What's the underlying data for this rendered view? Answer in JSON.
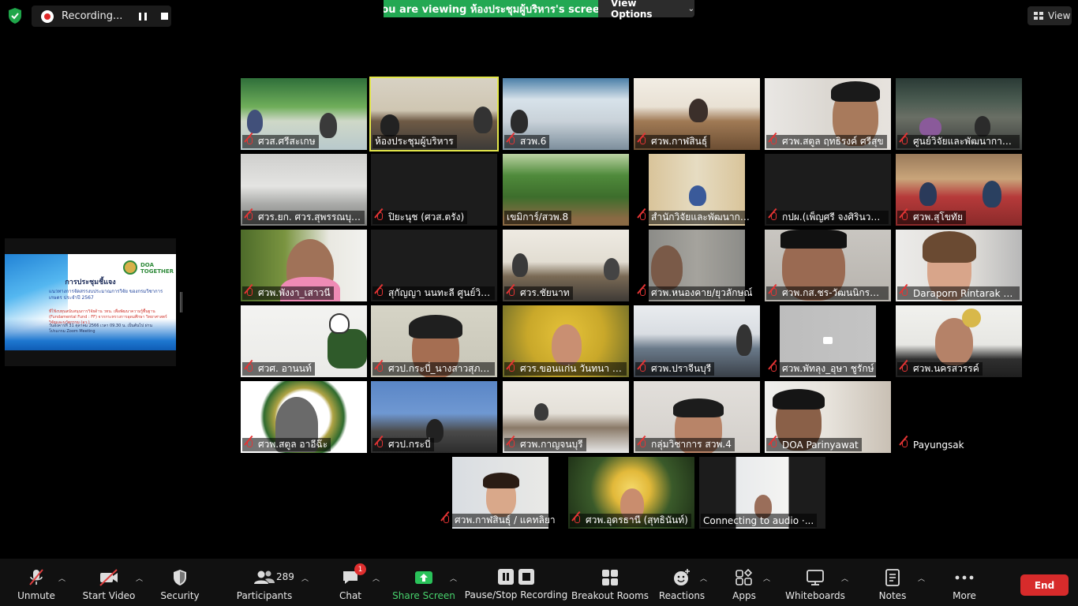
{
  "top": {
    "recording_label": "Recording...",
    "viewing_banner": "You are viewing ห้องประชุมผู้บริหาร's screen",
    "view_options": "View Options",
    "view_button": "View"
  },
  "shared_screen": {
    "title": "การประชุมชี้แจง",
    "subtitle": "แนวทางการจัดสรรงบประมาณการวิจัย ของกรมวิชาการเกษตร ประจำปี 2567",
    "line_red": "ที่ใช้งบทุนสนับสนุนการวิจัยด้าน วทน. เพื่อพัฒนาความรู้พื้นฐาน (Fundamental Fund : FF) จากกระทรวงการอุดมศึกษา วิทยาศาสตร์ วิจัยและนวัตกรรม (อว.)",
    "line_date": "วันอังคารที่ 31 ตุลาคม 2566 เวลา 09.30 น. เป็นต้นไป ผ่านโปรแกรม Zoom Meeting",
    "logo_text": "DOA TOGETHER"
  },
  "participants_tiles": [
    {
      "name": "ศวส.ศรีสะเกษ"
    },
    {
      "name": "ห้องประชุมผู้บริหาร"
    },
    {
      "name": "สวพ.6"
    },
    {
      "name": "ศวพ.กาฬสินธุ์"
    },
    {
      "name": "ศวพ.สตูล ฤทธิรงค์ ศรีสุข"
    },
    {
      "name": "ศูนย์วิจัยและพัฒนาการเก..."
    },
    {
      "name": "ศวร.ยก. ศวร.สุพรรณบุรี,..."
    },
    {
      "name": "ปิยะนุช (ศวส.ตรัง)"
    },
    {
      "name": "เขมิการ์/สวพ.8"
    },
    {
      "name": "สำนักวิจัยและพัฒนาการเ..."
    },
    {
      "name": "กปผ.(เพ็ญศรี จงศิรินวบุตร)"
    },
    {
      "name": "ศวพ.สุโขทัย"
    },
    {
      "name": "ศวพ.พังงา_เสาวนี"
    },
    {
      "name": "สุกัญญา นนทะลี ศูนย์วิจั..."
    },
    {
      "name": "ศวร.ชัยนาท"
    },
    {
      "name": "ศวพ.หนองคาย/ยุวลักษณ์"
    },
    {
      "name": "ศวพ.กส.ชร-วัฒนนิกรณ์ แ..."
    },
    {
      "name": "Daraporn Rintarak (P..."
    },
    {
      "name": "ศวศ. อานนท์"
    },
    {
      "name": "ศวป.กระบี่_นางสาวสุภาวดี..."
    },
    {
      "name": "ศวร.ขอนแก่น วันทนา เลิ..."
    },
    {
      "name": "ศวพ.ปราจีนบุรี"
    },
    {
      "name": "ศวพ.พัทลุง_อุษา ชูรักษ์"
    },
    {
      "name": "ศวพ.นครสวรรค์"
    },
    {
      "name": "ศวพ.สตูล อาอีฉ๊ะ"
    },
    {
      "name": "ศวป.กระบี่"
    },
    {
      "name": "ศวพ.กาญจนบุรี"
    },
    {
      "name": "กลุ่มวิชาการ สวพ.4"
    },
    {
      "name": "DOA Parinyawat"
    },
    {
      "name": "Payungsak"
    },
    {
      "name": "ศวพ.กาฬสินธุ์ / แคทลิยา"
    },
    {
      "name": "ศวพ.อุดรธานี (สุทธินันท์)"
    },
    {
      "name": "Connecting to audio ·..."
    }
  ],
  "toolbar": {
    "unmute": "Unmute",
    "start_video": "Start Video",
    "security": "Security",
    "participants": "Participants",
    "participants_count": "289",
    "chat": "Chat",
    "chat_badge": "1",
    "share_screen": "Share Screen",
    "pause_stop_recording": "Pause/Stop Recording",
    "breakout_rooms": "Breakout Rooms",
    "reactions": "Reactions",
    "apps": "Apps",
    "whiteboards": "Whiteboards",
    "notes": "Notes",
    "more": "More",
    "end": "End"
  },
  "colors": {
    "accent_green": "#23a853",
    "end_red": "#d72b2b",
    "active_speaker": "#e3e64a",
    "muted_red": "#e53434"
  }
}
